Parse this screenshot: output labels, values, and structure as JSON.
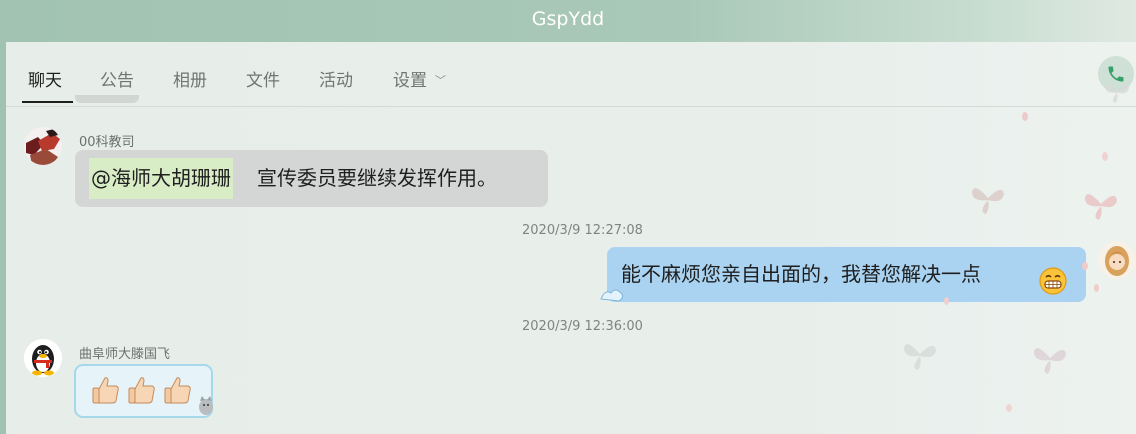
{
  "window": {
    "title": "GspYdd"
  },
  "tabs": [
    {
      "label": "聊天",
      "active": true
    },
    {
      "label": "公告"
    },
    {
      "label": "相册"
    },
    {
      "label": "文件"
    },
    {
      "label": "活动"
    },
    {
      "label": "设置"
    }
  ],
  "messages": [
    {
      "sender": "00科教司",
      "mention": "@海师大胡珊珊",
      "text": "宣传委员要继续发挥作用。"
    },
    {
      "timestamp": "2020/3/9 12:27:08",
      "text": "能不麻烦您亲自出面的，我替您解决一点",
      "outgoing": true,
      "emoji": "grin-emoji"
    },
    {
      "timestamp": "2020/3/9 12:36:00",
      "sender": "曲阜师大滕国飞",
      "content": "three thumbs-up emoji"
    }
  ],
  "colors": {
    "titlebar": "#a2c3b2",
    "window_bg": "#e8efeb",
    "incoming_bubble": "#d3d6d4",
    "outgoing_bubble": "#a9d3f1",
    "mention_highlight": "#d8ecc5",
    "phone_icon": "#3aa06a"
  }
}
